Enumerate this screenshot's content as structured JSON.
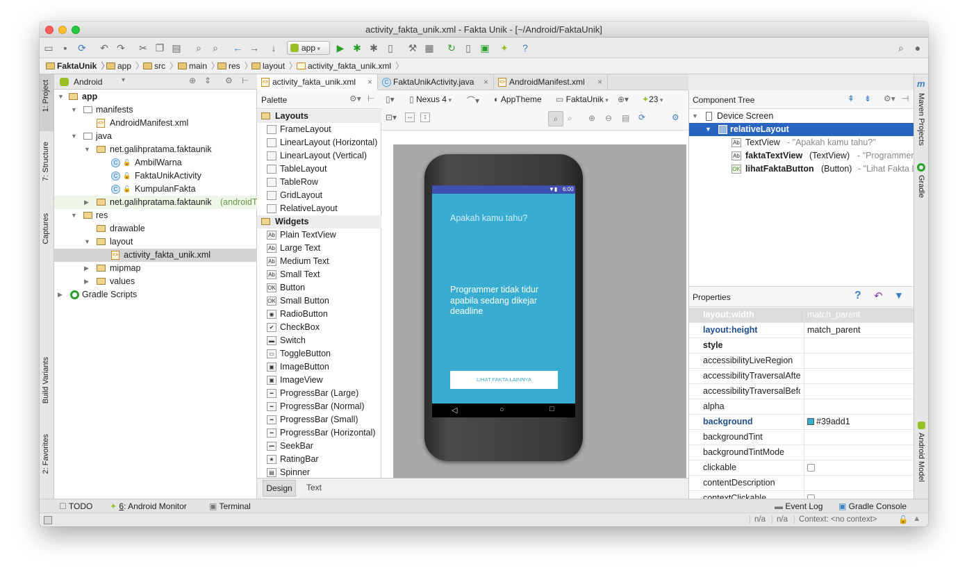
{
  "window": {
    "title": "activity_fakta_unik.xml - Fakta Unik - [~/Android/FaktaUnik]"
  },
  "toolbar": {
    "run_config": "app"
  },
  "breadcrumb": [
    "FaktaUnik",
    "app",
    "src",
    "main",
    "res",
    "layout",
    "activity_fakta_unik.xml"
  ],
  "left_tool_windows": [
    "1: Project",
    "7: Structure",
    "Captures",
    "Build Variants",
    "2: Favorites"
  ],
  "right_tool_windows": [
    "Maven Projects",
    "Gradle",
    "Android Model"
  ],
  "project": {
    "view_mode": "Android",
    "tree": [
      {
        "label": "app",
        "bold": true
      },
      {
        "label": "manifests"
      },
      {
        "label": "AndroidManifest.xml"
      },
      {
        "label": "java"
      },
      {
        "label": "net.galihpratama.faktaunik"
      },
      {
        "label": "AmbilWarna"
      },
      {
        "label": "FaktaUnikActivity"
      },
      {
        "label": "KumpulanFakta"
      },
      {
        "label": "net.galihpratama.faktaunik",
        "suffix": "(androidT"
      },
      {
        "label": "res"
      },
      {
        "label": "drawable"
      },
      {
        "label": "layout"
      },
      {
        "label": "activity_fakta_unik.xml"
      },
      {
        "label": "mipmap"
      },
      {
        "label": "values"
      },
      {
        "label": "Gradle Scripts"
      }
    ]
  },
  "editor_tabs": [
    "activity_fakta_unik.xml",
    "FaktaUnikActivity.java",
    "AndroidManifest.xml"
  ],
  "palette": {
    "title": "Palette",
    "items": [
      {
        "label": "Layouts",
        "group": true
      },
      {
        "label": "FrameLayout"
      },
      {
        "label": "LinearLayout (Horizontal)"
      },
      {
        "label": "LinearLayout (Vertical)"
      },
      {
        "label": "TableLayout"
      },
      {
        "label": "TableRow"
      },
      {
        "label": "GridLayout"
      },
      {
        "label": "RelativeLayout"
      },
      {
        "label": "Widgets",
        "group": true
      },
      {
        "label": "Plain TextView",
        "icon": "Ab"
      },
      {
        "label": "Large Text",
        "icon": "Ab"
      },
      {
        "label": "Medium Text",
        "icon": "Ab"
      },
      {
        "label": "Small Text",
        "icon": "Ab"
      },
      {
        "label": "Button",
        "icon": "OK"
      },
      {
        "label": "Small Button",
        "icon": "OK"
      },
      {
        "label": "RadioButton",
        "icon": "◉"
      },
      {
        "label": "CheckBox",
        "icon": "✔"
      },
      {
        "label": "Switch",
        "icon": "▬"
      },
      {
        "label": "ToggleButton",
        "icon": "▭"
      },
      {
        "label": "ImageButton",
        "icon": "▣"
      },
      {
        "label": "ImageView",
        "icon": "▣"
      },
      {
        "label": "ProgressBar (Large)",
        "icon": "━"
      },
      {
        "label": "ProgressBar (Normal)",
        "icon": "━"
      },
      {
        "label": "ProgressBar (Small)",
        "icon": "━"
      },
      {
        "label": "ProgressBar (Horizontal)",
        "icon": "━"
      },
      {
        "label": "SeekBar",
        "icon": "•━"
      },
      {
        "label": "RatingBar",
        "icon": "★"
      },
      {
        "label": "Spinner",
        "icon": "▤"
      }
    ]
  },
  "design_toolbar": {
    "device": "Nexus 4",
    "theme": "AppTheme",
    "activity": "FaktaUnik",
    "api": "23"
  },
  "phone": {
    "status_time": "6:00",
    "screen_bg": "#39add1",
    "question": "Apakah kamu tahu?",
    "fact": "Programmer tidak tidur apabila sedang dikejar deadline",
    "button": "LIHAT FAKTA LAINNYA"
  },
  "bottom_editor_tabs": [
    "Design",
    "Text"
  ],
  "component_tree": {
    "title": "Component Tree",
    "nodes": [
      {
        "name": "Device Screen",
        "detail": ""
      },
      {
        "name": "relativeLayout",
        "detail": ""
      },
      {
        "name": "TextView",
        "detail": "- \"Apakah kamu tahu?\""
      },
      {
        "name": "faktaTextView",
        "type": "(TextView)",
        "detail": "- \"Programmer"
      },
      {
        "name": "lihatFaktaButton",
        "type": "(Button)",
        "detail": "- \"Lihat Fakta L"
      }
    ]
  },
  "properties": {
    "title": "Properties",
    "rows": [
      {
        "key": "layout:width",
        "value": "match_parent"
      },
      {
        "key": "layout:height",
        "value": "match_parent"
      },
      {
        "key": "style",
        "value": ""
      },
      {
        "key": "accessibilityLiveRegion",
        "value": ""
      },
      {
        "key": "accessibilityTraversalAfter",
        "value": ""
      },
      {
        "key": "accessibilityTraversalBefore",
        "value": ""
      },
      {
        "key": "alpha",
        "value": ""
      },
      {
        "key": "background",
        "value": "#39add1"
      },
      {
        "key": "backgroundTint",
        "value": ""
      },
      {
        "key": "backgroundTintMode",
        "value": ""
      },
      {
        "key": "clickable",
        "value": ""
      },
      {
        "key": "contentDescription",
        "value": ""
      },
      {
        "key": "contextClickable",
        "value": ""
      }
    ]
  },
  "bottom_tools": {
    "todo": "TODO",
    "monitor_num": "6",
    "monitor_rest": ": Android Monitor",
    "terminal": "Terminal",
    "event_log": "Event Log",
    "gradle_console": "Gradle Console"
  },
  "status": {
    "n1": "n/a",
    "n2": "n/a",
    "context": "Context: <no context>"
  }
}
